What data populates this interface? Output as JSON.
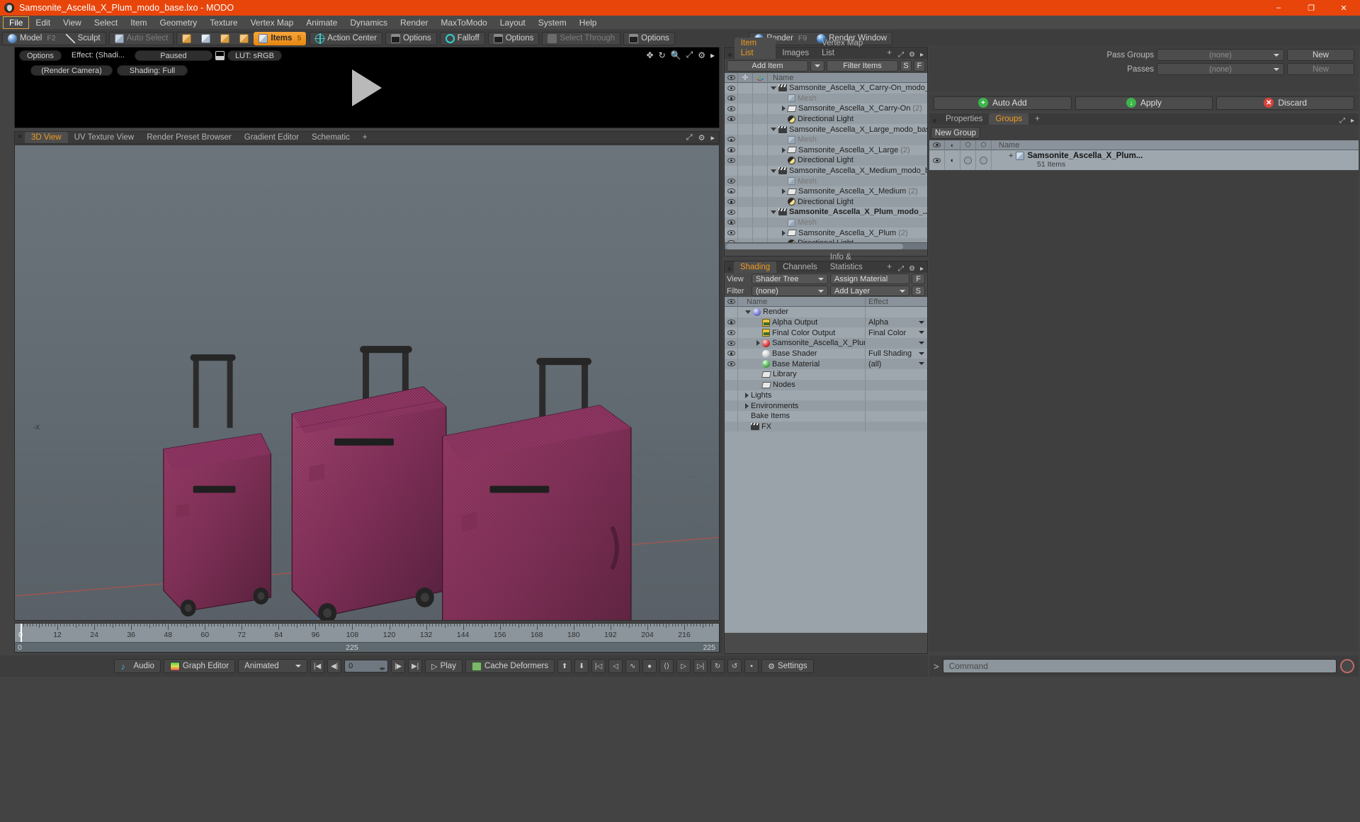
{
  "window": {
    "title": "Samsonite_Ascella_X_Plum_modo_base.lxo - MODO",
    "minimize": "–",
    "maximize": "❐",
    "close": "✕"
  },
  "menubar": [
    "File",
    "Edit",
    "View",
    "Select",
    "Item",
    "Geometry",
    "Texture",
    "Vertex Map",
    "Animate",
    "Dynamics",
    "Render",
    "MaxToModo",
    "Layout",
    "System",
    "Help"
  ],
  "modebar": {
    "model": "Model",
    "model_key": "F2",
    "sculpt": "Sculpt",
    "auto_select": "Auto Select",
    "items": "Items",
    "items_key": "5",
    "action_center": "Action Center",
    "options1": "Options",
    "falloff": "Falloff",
    "options2": "Options",
    "select_through": "Select Through",
    "options3": "Options",
    "render": "Render",
    "render_key": "F9",
    "render_window": "Render Window"
  },
  "render_preview": {
    "options": "Options",
    "effect": "Effect: (Shadi...",
    "paused": "Paused",
    "lut": "LUT: sRGB",
    "camera": "(Render Camera)",
    "shading": "Shading: Full"
  },
  "view_tabs": [
    {
      "label": "3D View",
      "active": true
    },
    {
      "label": "UV Texture View",
      "active": false
    },
    {
      "label": "Render Preset Browser",
      "active": false
    },
    {
      "label": "Gradient Editor",
      "active": false
    },
    {
      "label": "Schematic",
      "active": false
    },
    {
      "label": "+",
      "active": false
    }
  ],
  "viewport": {
    "axis_label": "-X"
  },
  "timeline": {
    "ticks": [
      "0",
      "12",
      "24",
      "36",
      "48",
      "60",
      "72",
      "84",
      "96",
      "108",
      "120",
      "132",
      "144",
      "156",
      "168",
      "180",
      "192",
      "204",
      "216"
    ],
    "range_start": "0",
    "range_mid": "225",
    "range_end": "225"
  },
  "bottom_toolbar": {
    "audio": "Audio",
    "graph_editor": "Graph Editor",
    "animated": "Animated",
    "frame_value": "0",
    "play": "Play",
    "cache_deformers": "Cache Deformers",
    "settings": "Settings"
  },
  "item_list": {
    "tabs": [
      {
        "label": "Item List",
        "active": true
      },
      {
        "label": "Images",
        "active": false
      },
      {
        "label": "Vertex Map List",
        "active": false
      },
      {
        "label": "+",
        "active": false
      }
    ],
    "add_item": "Add Item",
    "filter_items": "Filter Items",
    "btn_s": "S",
    "btn_f": "F",
    "name_header": "Name",
    "rows": [
      {
        "label": "Samsonite_Ascella_X_Carry-On_modo_ba...",
        "indent": 1,
        "icon": "slate-icon",
        "expander": "down",
        "eye": true,
        "bold": false,
        "count": ""
      },
      {
        "label": "Mesh",
        "indent": 2,
        "icon": "mesh-icon",
        "expander": "none",
        "eye": true,
        "bold": false,
        "dim": true,
        "count": ""
      },
      {
        "label": "Samsonite_Ascella_X_Carry-On",
        "indent": 2,
        "icon": "folder-icon",
        "expander": "right",
        "eye": true,
        "bold": false,
        "count": "(2)"
      },
      {
        "label": "Directional Light",
        "indent": 2,
        "icon": "light-icon",
        "expander": "none",
        "eye": true,
        "bold": false,
        "count": ""
      },
      {
        "label": "Samsonite_Ascella_X_Large_modo_base.lxo",
        "indent": 1,
        "icon": "slate-icon",
        "expander": "down",
        "eye": false,
        "bold": false,
        "count": ""
      },
      {
        "label": "Mesh",
        "indent": 2,
        "icon": "mesh-icon",
        "expander": "none",
        "eye": true,
        "bold": false,
        "dim": true,
        "count": ""
      },
      {
        "label": "Samsonite_Ascella_X_Large",
        "indent": 2,
        "icon": "folder-icon",
        "expander": "right",
        "eye": true,
        "bold": false,
        "count": "(2)"
      },
      {
        "label": "Directional Light",
        "indent": 2,
        "icon": "light-icon",
        "expander": "none",
        "eye": true,
        "bold": false,
        "count": ""
      },
      {
        "label": "Samsonite_Ascella_X_Medium_modo_base...",
        "indent": 1,
        "icon": "slate-icon",
        "expander": "down",
        "eye": false,
        "bold": false,
        "count": ""
      },
      {
        "label": "Mesh",
        "indent": 2,
        "icon": "mesh-icon",
        "expander": "none",
        "eye": true,
        "bold": false,
        "dim": true,
        "count": ""
      },
      {
        "label": "Samsonite_Ascella_X_Medium",
        "indent": 2,
        "icon": "folder-icon",
        "expander": "right",
        "eye": true,
        "bold": false,
        "count": "(2)"
      },
      {
        "label": "Directional Light",
        "indent": 2,
        "icon": "light-icon",
        "expander": "none",
        "eye": true,
        "bold": false,
        "count": ""
      },
      {
        "label": "Samsonite_Ascella_X_Plum_modo_...",
        "indent": 1,
        "icon": "slate-icon",
        "expander": "down",
        "eye": true,
        "bold": true,
        "count": ""
      },
      {
        "label": "Mesh",
        "indent": 2,
        "icon": "mesh-icon",
        "expander": "none",
        "eye": true,
        "bold": false,
        "dim": true,
        "count": ""
      },
      {
        "label": "Samsonite_Ascella_X_Plum",
        "indent": 2,
        "icon": "folder-icon",
        "expander": "right",
        "eye": true,
        "bold": false,
        "count": "(2)"
      },
      {
        "label": "Directional Light",
        "indent": 2,
        "icon": "light-icon",
        "expander": "none",
        "eye": true,
        "bold": false,
        "count": ""
      }
    ]
  },
  "shading": {
    "tabs": [
      {
        "label": "Shading",
        "active": true
      },
      {
        "label": "Channels",
        "active": false
      },
      {
        "label": "Info & Statistics",
        "active": false
      },
      {
        "label": "+",
        "active": false
      }
    ],
    "view_label": "View",
    "view_value": "Shader Tree",
    "assign_material": "Assign Material",
    "filter_label": "Filter",
    "filter_value": "(none)",
    "add_layer": "Add Layer",
    "btn_f": "F",
    "btn_s": "S",
    "name_header": "Name",
    "effect_header": "Effect",
    "rows": [
      {
        "label": "Render",
        "effect": "",
        "indent": 1,
        "icon": "render-sphere-icon",
        "expander": "down",
        "eye": false,
        "dropdown": false
      },
      {
        "label": "Alpha Output",
        "effect": "Alpha",
        "indent": 2,
        "icon": "image-icon",
        "expander": "none",
        "eye": true,
        "dropdown": true
      },
      {
        "label": "Final Color Output",
        "effect": "Final Color",
        "indent": 2,
        "icon": "image-icon",
        "expander": "none",
        "eye": true,
        "dropdown": true
      },
      {
        "label": "Samsonite_Ascella_X_Plum",
        "effect": "",
        "suffix": "(...",
        "indent": 2,
        "icon": "red-sphere-icon",
        "expander": "right",
        "eye": true,
        "dropdown": true
      },
      {
        "label": "Base Shader",
        "effect": "Full Shading",
        "indent": 2,
        "icon": "white-sphere-icon",
        "expander": "none",
        "eye": true,
        "dropdown": true
      },
      {
        "label": "Base Material",
        "effect": "(all)",
        "indent": 2,
        "icon": "green-sphere-icon",
        "expander": "none",
        "eye": true,
        "dropdown": true
      },
      {
        "label": "Library",
        "effect": "",
        "indent": 2,
        "icon": "folder-icon",
        "expander": "none",
        "eye": false,
        "dropdown": false
      },
      {
        "label": "Nodes",
        "effect": "",
        "indent": 2,
        "icon": "folder-icon",
        "expander": "none",
        "eye": false,
        "dropdown": false
      },
      {
        "label": "Lights",
        "effect": "",
        "indent": 1,
        "icon": "none",
        "expander": "right",
        "eye": false,
        "dropdown": false
      },
      {
        "label": "Environments",
        "effect": "",
        "indent": 1,
        "icon": "none",
        "expander": "right",
        "eye": false,
        "dropdown": false
      },
      {
        "label": "Bake Items",
        "effect": "",
        "indent": 1,
        "icon": "none",
        "expander": "none",
        "eye": false,
        "dropdown": false
      },
      {
        "label": "FX",
        "effect": "",
        "indent": 1,
        "icon": "slate-icon",
        "expander": "none",
        "eye": false,
        "dropdown": false
      }
    ]
  },
  "passes": {
    "pass_groups_label": "Pass Groups",
    "pass_groups_value": "(none)",
    "pass_groups_new": "New",
    "passes_label": "Passes",
    "passes_value": "(none)",
    "passes_new": "New",
    "auto_add": "Auto Add",
    "apply": "Apply",
    "discard": "Discard"
  },
  "groups": {
    "tabs": [
      {
        "label": "Properties",
        "active": false
      },
      {
        "label": "Groups",
        "active": true
      },
      {
        "label": "+",
        "active": false
      }
    ],
    "new_group": "New Group",
    "name_header": "Name",
    "row_name": "Samsonite_Ascella_X_Plum...",
    "row_sub": "51 Items",
    "row_expander": "+"
  },
  "command_bar": {
    "prompt": ">",
    "placeholder": "Command"
  },
  "colors": {
    "title_bg": "#e8450b",
    "accent": "#f09a1e",
    "panel_bg": "#3e3e3e",
    "tree_bg": "#9aa3aa",
    "viewport_bg": "#5e676e",
    "luggage": "#9e3b6e"
  }
}
